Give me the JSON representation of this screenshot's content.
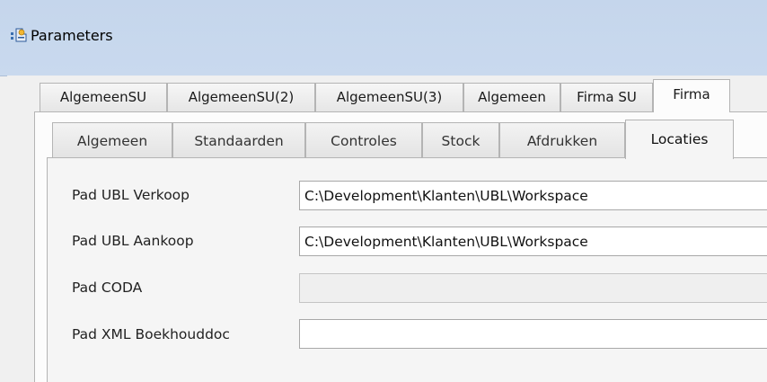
{
  "window": {
    "title": "Parameters"
  },
  "tabs_outer": [
    "AlgemeenSU",
    "AlgemeenSU(2)",
    "AlgemeenSU(3)",
    "Algemeen",
    "Firma SU",
    "Firma"
  ],
  "tabs_outer_active": "Firma",
  "tabs_inner": [
    "Algemeen",
    "Standaarden",
    "Controles",
    "Stock",
    "Afdrukken",
    "Locaties"
  ],
  "tabs_inner_active": "Locaties",
  "fields": [
    {
      "label": "Pad UBL Verkoop",
      "value": "C:\\Development\\Klanten\\UBL\\Workspace",
      "disabled": false
    },
    {
      "label": "Pad UBL Aankoop",
      "value": "C:\\Development\\Klanten\\UBL\\Workspace",
      "disabled": false
    },
    {
      "label": "Pad CODA",
      "value": "",
      "disabled": true
    },
    {
      "label": "Pad XML Boekhouddoc",
      "value": "",
      "disabled": false
    }
  ]
}
